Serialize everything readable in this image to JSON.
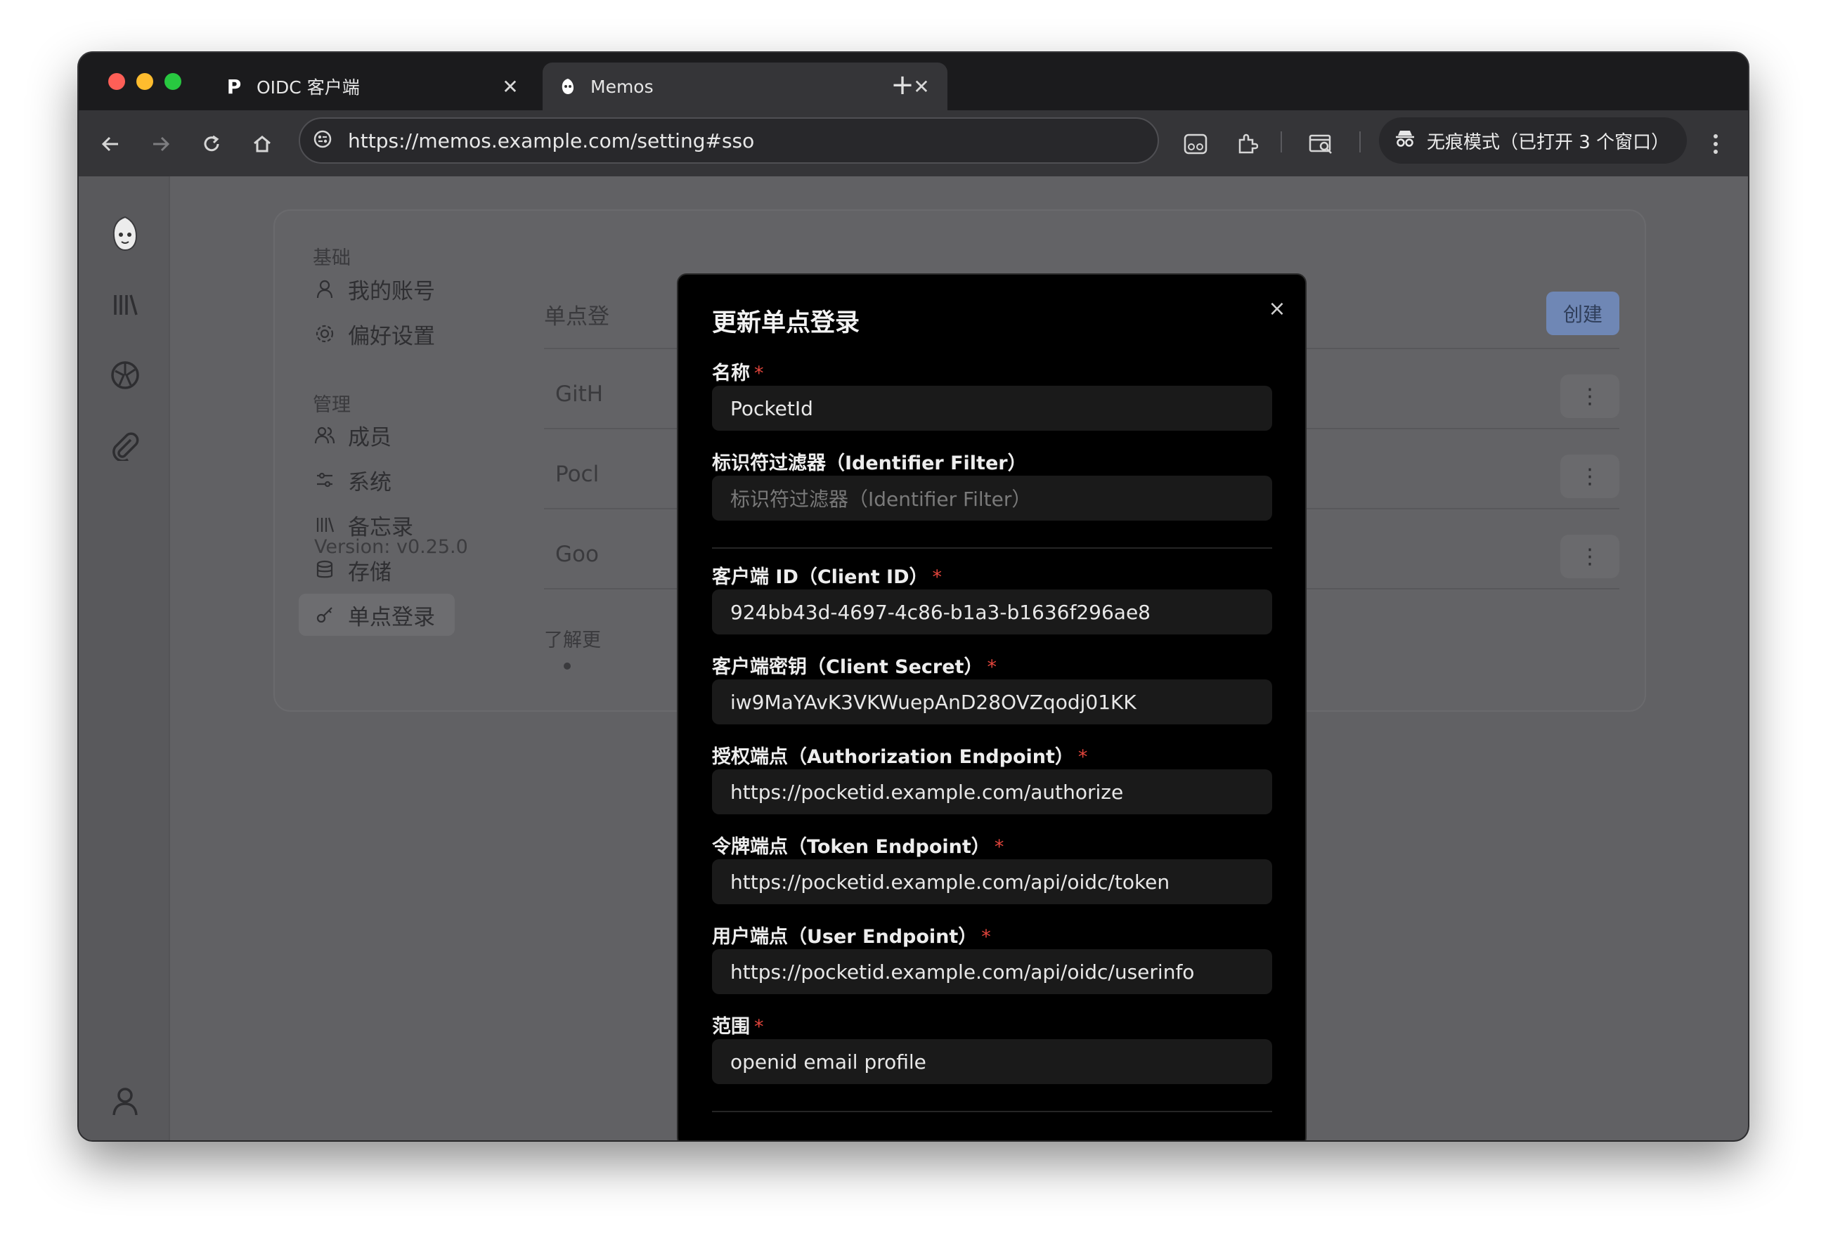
{
  "browser": {
    "tabs": [
      {
        "favicon": "P",
        "title": "OIDC 客户端"
      },
      {
        "title": "Memos"
      }
    ],
    "address": "https://memos.example.com/setting#sso",
    "incognito_label": "无痕模式（已打开 3 个窗口）"
  },
  "settings_nav": {
    "section_basic": "基础",
    "my_account": "我的账号",
    "preferences": "偏好设置",
    "section_admin": "管理",
    "members": "成员",
    "system": "系统",
    "memos": "备忘录",
    "storage": "存储",
    "sso": "单点登录",
    "version": "Version: v0.25.0"
  },
  "sso_panel": {
    "heading": "单点登",
    "create_label": "创建",
    "rows": [
      "GitH",
      "Pocl",
      "Goo"
    ],
    "more_label": "⋮",
    "learn_more": "了解更"
  },
  "modal": {
    "title": "更新单点登录",
    "close_label": "×",
    "fields": {
      "name": {
        "label": "名称",
        "value": "PocketId"
      },
      "identifier_filter": {
        "label": "标识符过滤器（Identifier Filter）",
        "placeholder": "标识符过滤器（Identifier Filter）"
      },
      "client_id": {
        "label": "客户端 ID（Client ID）",
        "value": "924bb43d-4697-4c86-b1a3-b1636f296ae8"
      },
      "client_secret": {
        "label": "客户端密钥（Client Secret）",
        "value": "iw9MaYAvK3VKWuepAnD28OVZqodj01KK"
      },
      "auth_endpoint": {
        "label": "授权端点（Authorization Endpoint）",
        "value": "https://pocketid.example.com/authorize"
      },
      "token_endpoint": {
        "label": "令牌端点（Token Endpoint）",
        "value": "https://pocketid.example.com/api/oidc/token"
      },
      "user_endpoint": {
        "label": "用户端点（User Endpoint）",
        "value": "https://pocketid.example.com/api/oidc/userinfo"
      },
      "scopes": {
        "label": "范围",
        "value": "openid email profile"
      }
    },
    "required_mark": "*"
  }
}
